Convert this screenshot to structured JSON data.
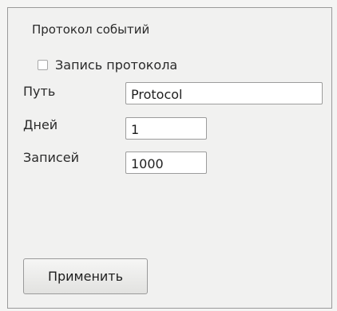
{
  "group": {
    "title": "Протокол событий"
  },
  "logging_checkbox": {
    "label": "Запись протокола",
    "checked": false
  },
  "fields": {
    "path": {
      "label": "Путь",
      "value": "Protocol"
    },
    "days": {
      "label": "Дней",
      "value": "1"
    },
    "records": {
      "label": "Записей",
      "value": "1000"
    }
  },
  "buttons": {
    "apply_label": "Применить"
  }
}
